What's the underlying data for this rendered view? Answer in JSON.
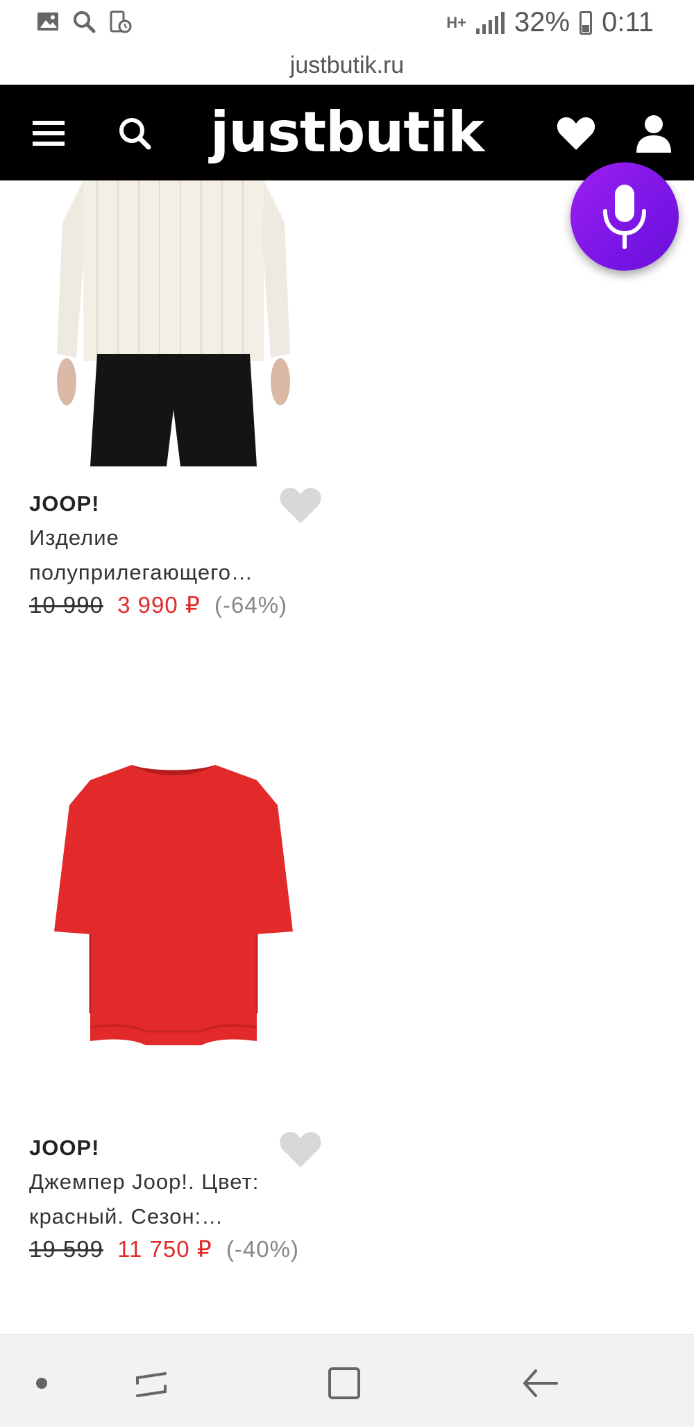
{
  "status_bar": {
    "network": "H+",
    "battery": "32%",
    "time": "0:11",
    "icons": [
      "gallery-icon",
      "search-icon",
      "screen-record-icon"
    ]
  },
  "url": "justbutik.ru",
  "header": {
    "logo": "justbutik",
    "icons": [
      "menu-icon",
      "search-icon",
      "heart-icon",
      "user-icon"
    ]
  },
  "mic_fab": {
    "icon": "microphone-icon",
    "color": "#8a1aee"
  },
  "products": [
    {
      "image": "cream-knit-sweater",
      "brand": "JOOP!",
      "desc_line1": "Изделие",
      "desc_line2": "полуприлегающего…",
      "old_price": "10 990",
      "new_price": "3 990 ₽",
      "discount": "(-64%)"
    },
    {
      "image": "red-jumper",
      "brand": "JOOP!",
      "desc_line1": "Джемпер Joop!. Цвет:",
      "desc_line2": "красный. Сезон:…",
      "old_price": "19 599",
      "new_price": "11 750 ₽",
      "discount": "(-40%)"
    }
  ],
  "colors": {
    "price_red": "#e02b2b",
    "header_bg": "#000000",
    "nav_bg": "#f2f2f4"
  },
  "nav_bar": {
    "icons": [
      "dot-icon",
      "recent-apps-icon",
      "home-icon",
      "back-icon"
    ]
  }
}
